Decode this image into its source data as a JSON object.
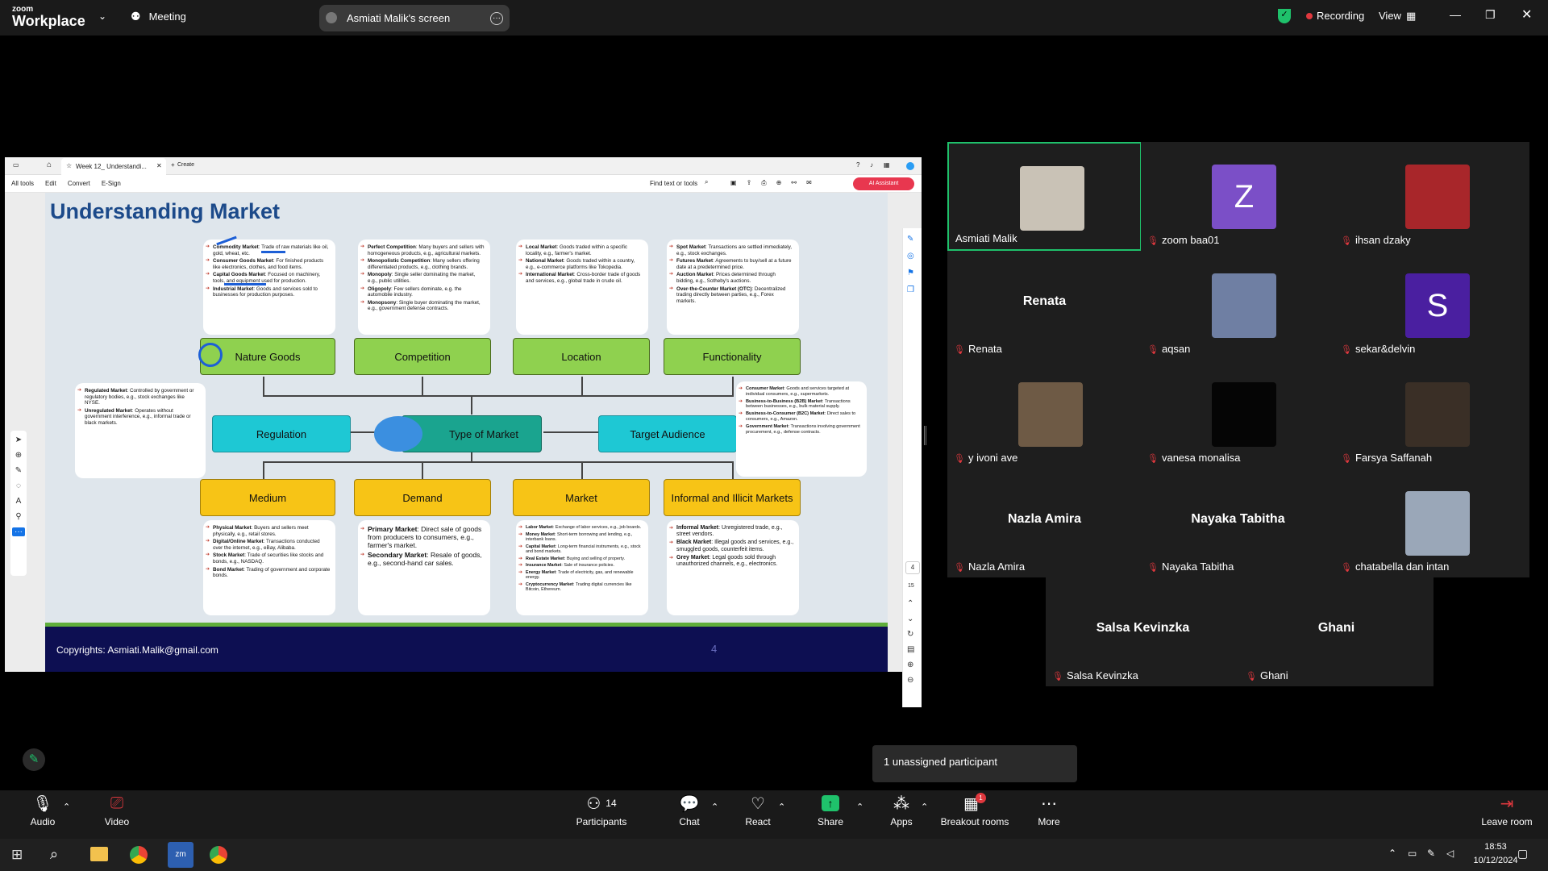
{
  "zoom": {
    "brand_small": "zoom",
    "brand_large": "Workplace",
    "meeting_label": "Meeting",
    "screen_title": "Asmiati Malik's screen",
    "recording_label": "Recording",
    "view_label": "View"
  },
  "browser": {
    "tab_title": "Week 12_ Understandi...",
    "create_label": "Create",
    "menu": [
      "All tools",
      "Edit",
      "Convert",
      "E-Sign"
    ],
    "find_label": "Find text or tools",
    "ai_label": "AI Assistant"
  },
  "slide": {
    "title": "Understanding Market",
    "center": "Type of Market",
    "top_boxes": [
      "Nature Goods",
      "Competition",
      "Location",
      "Functionality"
    ],
    "mid_boxes": [
      "Regulation",
      "Target Audience"
    ],
    "bottom_boxes": [
      "Medium",
      "Demand",
      "Market",
      "Informal and Illicit Markets"
    ],
    "footer": "Copyrights: Asmiati.Malik@gmail.com",
    "page": "4",
    "side_page": "4",
    "side_total": "15",
    "notes": {
      "nature": [
        [
          "Commodity Market",
          "Trade of raw materials like oil, gold, wheat, etc."
        ],
        [
          "Consumer Goods Market",
          "For finished products like electronics, clothes, and food items."
        ],
        [
          "Capital Goods Market",
          "Focused on machinery, tools, and equipment used for production."
        ],
        [
          "Industrial Market",
          "Goods and services sold to businesses for production purposes."
        ]
      ],
      "competition": [
        [
          "Perfect Competition",
          "Many buyers and sellers with homogeneous products, e.g., agricultural markets."
        ],
        [
          "Monopolistic Competition",
          "Many sellers offering differentiated products, e.g., clothing brands."
        ],
        [
          "Monopoly",
          "Single seller dominating the market, e.g., public utilities."
        ],
        [
          "Oligopoly",
          "Few sellers dominate, e.g. the automobile industry."
        ],
        [
          "Monopsony",
          "Single buyer dominating the market, e.g., government defense contracts."
        ]
      ],
      "location": [
        [
          "Local Market",
          "Goods traded within a specific locality, e.g., farmer's market."
        ],
        [
          "National Market",
          "Goods traded within a country, e.g., e-commerce platforms like Tokopedia."
        ],
        [
          "International Market",
          "Cross-border trade of goods and services, e.g., global trade in crude oil."
        ]
      ],
      "functionality": [
        [
          "Spot Market",
          "Transactions are settled immediately, e.g., stock exchanges."
        ],
        [
          "Futures Market",
          "Agreements to buy/sell at a future date at a predetermined price."
        ],
        [
          "Auction Market",
          "Prices determined through bidding, e.g., Sotheby's auctions."
        ],
        [
          "Over-the-Counter Market (OTC)",
          "Decentralized trading directly between parties, e.g., Forex markets."
        ]
      ],
      "regulation": [
        [
          "Regulated Market",
          "Controlled by government or regulatory bodies, e.g., stock exchanges like NYSE."
        ],
        [
          "Unregulated Market",
          "Operates without government interference, e.g., informal trade or black markets."
        ]
      ],
      "target": [
        [
          "Consumer Market",
          "Goods and services targeted at individual consumers, e.g., supermarkets."
        ],
        [
          "Business-to-Business (B2B) Market",
          "Transactions between businesses, e.g., bulk material supply."
        ],
        [
          "Business-to-Consumer (B2C) Market",
          "Direct sales to consumers, e.g., Amazon."
        ],
        [
          "Government Market",
          "Transactions involving government procurement, e.g., defense contracts."
        ]
      ],
      "medium": [
        [
          "Physical Market",
          "Buyers and sellers meet physically, e.g., retail stores."
        ],
        [
          "Digital/Online Market",
          "Transactions conducted over the internet, e.g., eBay, Alibaba."
        ],
        [
          "Stock Market",
          "Trade of securities like stocks and bonds, e.g., NASDAQ."
        ],
        [
          "Bond Market",
          "Trading of government and corporate bonds."
        ]
      ],
      "demand": [
        [
          "Primary Market",
          "Direct sale of goods from producers to consumers, e.g., farmer's market."
        ],
        [
          "Secondary Market",
          "Resale of goods, e.g., second-hand car sales."
        ]
      ],
      "market": [
        [
          "Labor Market",
          "Exchange of labor services, e.g., job boards."
        ],
        [
          "Money Market",
          "Short-term borrowing and lending, e.g., interbank loans."
        ],
        [
          "Capital Market",
          "Long-term financial instruments, e.g., stock and bond markets."
        ],
        [
          "Real Estate Market",
          "Buying and selling of property."
        ],
        [
          "Insurance Market",
          "Sale of insurance policies."
        ],
        [
          "Energy Market",
          "Trade of electricity, gas, and renewable energy."
        ],
        [
          "Cryptocurrency Market",
          "Trading digital currencies like Bitcoin, Ethereum."
        ]
      ],
      "informal": [
        [
          "Informal Market",
          "Unregistered trade, e.g., street vendors."
        ],
        [
          "Black Market",
          "Illegal goods and services, e.g., smuggled goods, counterfeit items."
        ],
        [
          "Grey Market",
          "Legal goods sold through unauthorized channels, e.g., electronics."
        ]
      ]
    }
  },
  "participants": [
    {
      "name": "Asmiati Malik",
      "kind": "photo",
      "color": "#c9c2b6",
      "muted": false
    },
    {
      "name": "zoom baa01",
      "kind": "letter",
      "letter": "Z",
      "color": "#7b4fc7",
      "muted": true
    },
    {
      "name": "ihsan dzaky",
      "kind": "photo",
      "color": "#a8262a",
      "muted": true
    },
    {
      "name": "Renata",
      "kind": "name",
      "muted": true
    },
    {
      "name": "aqsan",
      "kind": "photo",
      "color": "#6f7fa3",
      "muted": true
    },
    {
      "name": "sekar&delvin",
      "kind": "letter",
      "letter": "S",
      "color": "#4a1fa0",
      "muted": true
    },
    {
      "name": "y ivoni ave",
      "kind": "photo",
      "color": "#6e5a45",
      "muted": true
    },
    {
      "name": "vanesa monalisa",
      "kind": "photo",
      "color": "#050505",
      "muted": true
    },
    {
      "name": "Farsya Saffanah",
      "kind": "photo",
      "color": "#3a2f26",
      "muted": true
    },
    {
      "name": "Nazla Amira",
      "kind": "name",
      "muted": true
    },
    {
      "name": "Nayaka Tabitha",
      "kind": "name",
      "muted": true
    },
    {
      "name": "chatabella dan intan",
      "kind": "photo",
      "color": "#9aa7b8",
      "muted": true
    },
    {
      "name": "Salsa Kevinzka",
      "kind": "name",
      "muted": true
    },
    {
      "name": "Ghani",
      "kind": "name",
      "muted": true
    }
  ],
  "unassigned": "1 unassigned participant",
  "toolbar": {
    "audio": "Audio",
    "video": "Video",
    "participants": "Participants",
    "participants_count": "14",
    "chat": "Chat",
    "react": "React",
    "share": "Share",
    "apps": "Apps",
    "breakout": "Breakout rooms",
    "breakout_badge": "1",
    "more": "More",
    "leave": "Leave room"
  },
  "taskbar": {
    "time": "18:53",
    "date": "10/12/2024"
  },
  "colors": {
    "accent_green": "#1fc16b",
    "record_red": "#e0383e",
    "slide_title": "#1c4a8a",
    "footer_bg": "#0d0f52"
  }
}
